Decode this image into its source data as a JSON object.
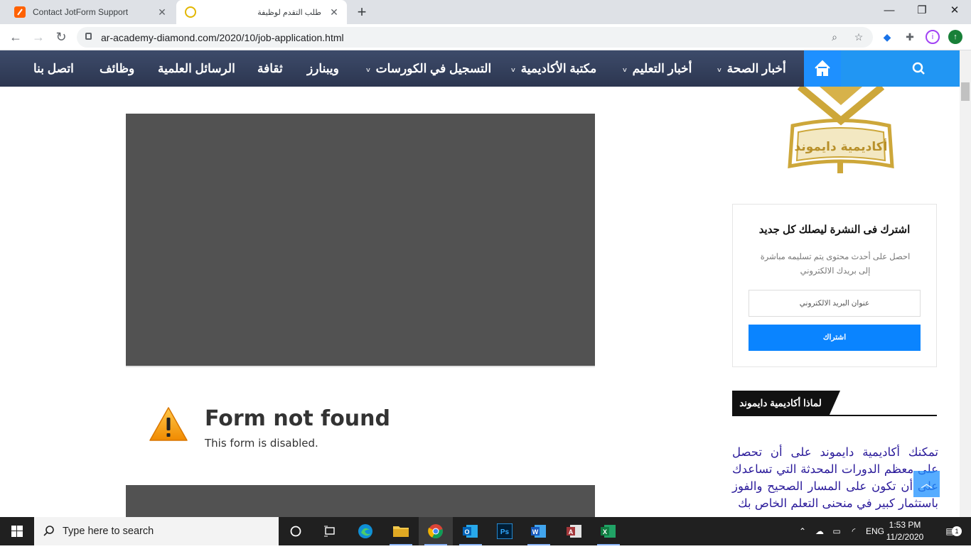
{
  "browser": {
    "tabs": [
      {
        "title": "Contact JotForm Support",
        "active": false
      },
      {
        "title": "طلب التقدم لوظيفة",
        "active": true
      }
    ],
    "new_tab_label": "+",
    "close_symbol": "✕",
    "window_controls": {
      "minimize": "—",
      "maximize": "❐",
      "close": "✕"
    },
    "url": "ar-academy-diamond.com/2020/10/job-application.html"
  },
  "site": {
    "nav_items": [
      {
        "label": "أخبار الصحة",
        "dropdown": true
      },
      {
        "label": "أخبار التعليم",
        "dropdown": true
      },
      {
        "label": "مكتبة الأكاديمية",
        "dropdown": true
      },
      {
        "label": "التسجيل في الكورسات",
        "dropdown": true
      },
      {
        "label": "ويبنارز",
        "dropdown": false
      },
      {
        "label": "ثقافة",
        "dropdown": false
      },
      {
        "label": "الرسائل العلمية",
        "dropdown": false
      },
      {
        "label": "وظائف",
        "dropdown": false
      },
      {
        "label": "اتصل بنا",
        "dropdown": false
      }
    ],
    "nav_caret": "˅",
    "accent_color": "#1e90ff",
    "form": {
      "error_title": "Form not found",
      "error_subtitle": "This form is disabled."
    },
    "sidebar": {
      "logo_text": "أكاديمية دايموند",
      "newsletter_title": "اشترك فى النشرة ليصلك كل جديد",
      "newsletter_desc": "احصل على أحدث محتوى يتم تسليمه مباشرة إلى بريدك الالكتروني",
      "email_placeholder": "عنوان البريد الالكتروني",
      "subscribe_label": "اشتراك",
      "why_title": "لماذا أكاديمية دايموند",
      "why_text": "تمكنك أكاديمية دايموند على أن تحصل على معظم الدورات المحدثة التي تساعدك على أن تكون على المسار الصحيح والفوز باستثمار كبير في منحنى التعلم الخاص بك"
    }
  },
  "taskbar": {
    "search_placeholder": "Type here to search",
    "lang": "ENG",
    "time": "1:53 PM",
    "date": "11/2/2020",
    "notification_count": "1",
    "apps": [
      "task-view",
      "edge",
      "file-explorer",
      "chrome",
      "outlook",
      "photoshop",
      "word",
      "access",
      "excel"
    ]
  }
}
